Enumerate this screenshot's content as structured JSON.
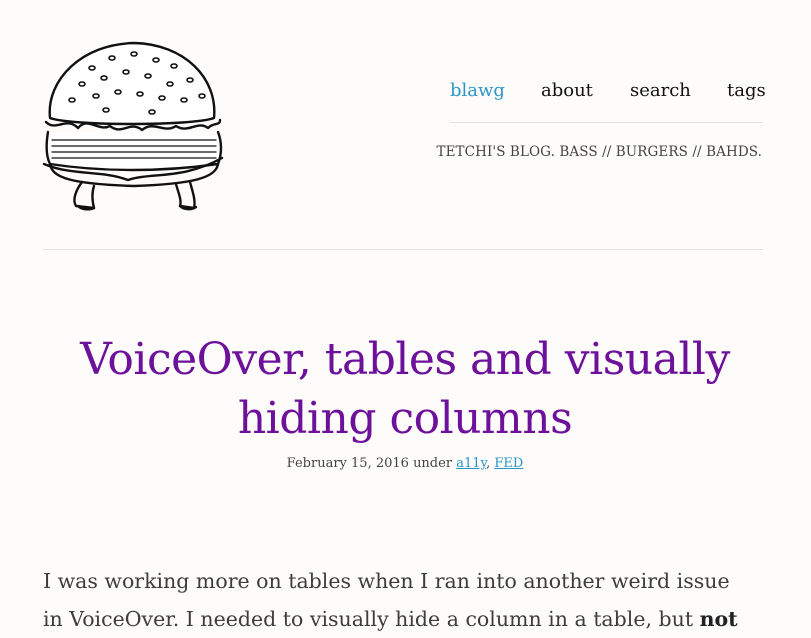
{
  "header": {
    "logo_icon": "burger-logo-icon",
    "nav": [
      {
        "label": "blawg",
        "active": true
      },
      {
        "label": "about",
        "active": false
      },
      {
        "label": "search",
        "active": false
      },
      {
        "label": "tags",
        "active": false
      }
    ],
    "tagline": "TETCHI'S BLOG. BASS // BURGERS // BAHDS."
  },
  "post": {
    "title_line1": "VoiceOver, tables and visually",
    "title_line2": "hiding columns",
    "date": "February 15, 2016",
    "under_label": "under",
    "tags": [
      "a11y",
      "FED"
    ],
    "tag_separator": ",",
    "paragraph_line1": "I was working more on tables when I ran into another weird issue",
    "paragraph_line2_start": "in VoiceOver. I needed to visually hide a column in a table, but",
    "paragraph_line2_bold": "not"
  },
  "colors": {
    "accent": "#2b95c8",
    "title": "#6d119b",
    "background": "#fdfcfb"
  }
}
